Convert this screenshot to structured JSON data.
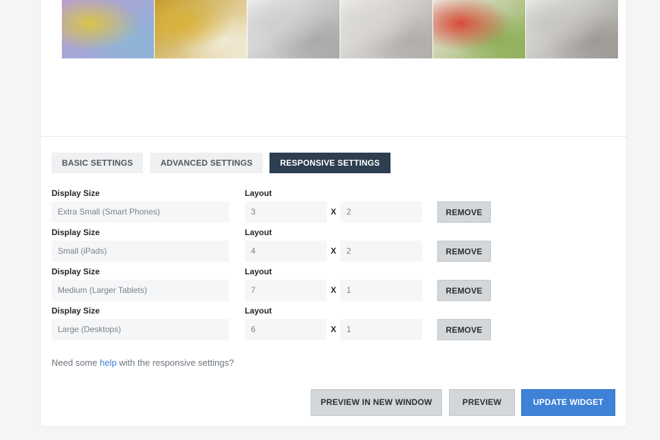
{
  "gallery": {
    "images": [
      {
        "name": "sketch-thumbnail",
        "colors": [
          "#d9c44a",
          "#8fb4d8",
          "#b79cd6"
        ]
      },
      {
        "name": "sketch-thumbnail",
        "colors": [
          "#d9b33a",
          "#f0ead5",
          "#c49a2a"
        ]
      },
      {
        "name": "sketch-thumbnail",
        "colors": [
          "#cfcfcf",
          "#a9a9a9",
          "#eeeeee"
        ]
      },
      {
        "name": "sketch-thumbnail",
        "colors": [
          "#d8d6d3",
          "#b1aea9",
          "#efede9"
        ]
      },
      {
        "name": "sketch-thumbnail",
        "colors": [
          "#d84b3a",
          "#8fb05a",
          "#f0e8e0"
        ]
      },
      {
        "name": "sketch-thumbnail",
        "colors": [
          "#c8c6c2",
          "#9d9a95",
          "#ecebe8"
        ]
      }
    ]
  },
  "tabs": [
    {
      "label": "BASIC SETTINGS",
      "active": false
    },
    {
      "label": "ADVANCED SETTINGS",
      "active": false
    },
    {
      "label": "RESPONSIVE SETTINGS",
      "active": true
    }
  ],
  "responsive": {
    "display_size_label": "Display Size",
    "layout_label": "Layout",
    "x_label": "X",
    "remove_label": "REMOVE",
    "rows": [
      {
        "display": "Extra Small (Smart Phones)",
        "cols": "3",
        "rows": "2"
      },
      {
        "display": "Small (iPads)",
        "cols": "4",
        "rows": "2"
      },
      {
        "display": "Medium (Larger Tablets)",
        "cols": "7",
        "rows": "1"
      },
      {
        "display": "Large (Desktops)",
        "cols": "6",
        "rows": "1"
      }
    ]
  },
  "help": {
    "prefix": "Need some ",
    "link": "help",
    "suffix": " with the responsive settings?"
  },
  "footer": {
    "preview_new_window": "PREVIEW IN NEW WINDOW",
    "preview": "PREVIEW",
    "update": "UPDATE WIDGET"
  },
  "colors": {
    "accent": "#3d82d6",
    "active_tab": "#2c3e50"
  }
}
